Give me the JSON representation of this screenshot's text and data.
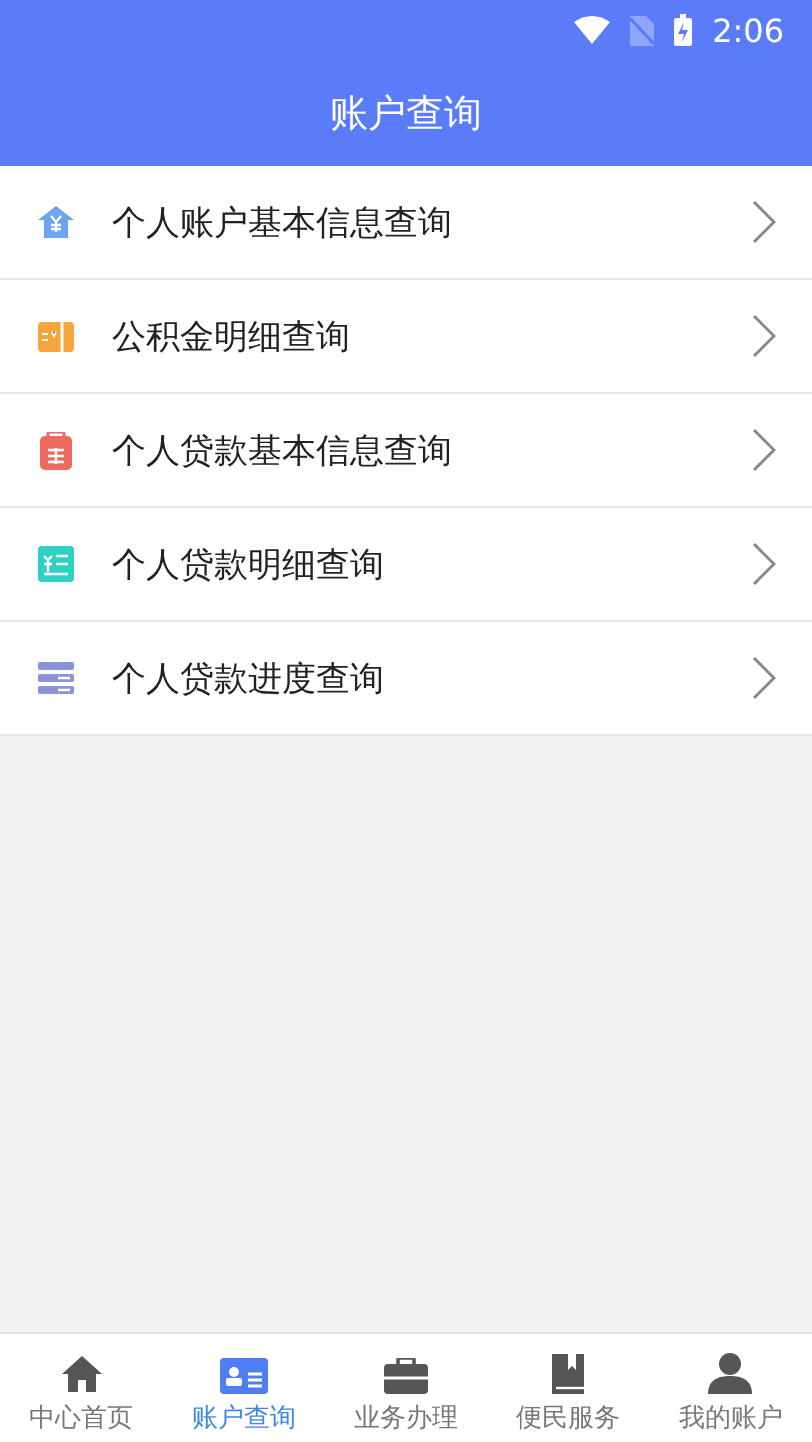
{
  "status_bar": {
    "time": "2:06"
  },
  "header": {
    "title": "账户查询"
  },
  "menu": [
    {
      "label": "个人账户基本信息查询",
      "color": "#6ea6ee"
    },
    {
      "label": "公积金明细查询",
      "color": "#f5a53b"
    },
    {
      "label": "个人贷款基本信息查询",
      "color": "#ee6a60"
    },
    {
      "label": "个人贷款明细查询",
      "color": "#2fd0c4"
    },
    {
      "label": "个人贷款进度查询",
      "color": "#8c93d8"
    }
  ],
  "tab_bar": [
    {
      "label": "中心首页",
      "selected": false
    },
    {
      "label": "账户查询",
      "selected": true
    },
    {
      "label": "业务办理",
      "selected": false
    },
    {
      "label": "便民服务",
      "selected": false
    },
    {
      "label": "我的账户",
      "selected": false
    }
  ]
}
